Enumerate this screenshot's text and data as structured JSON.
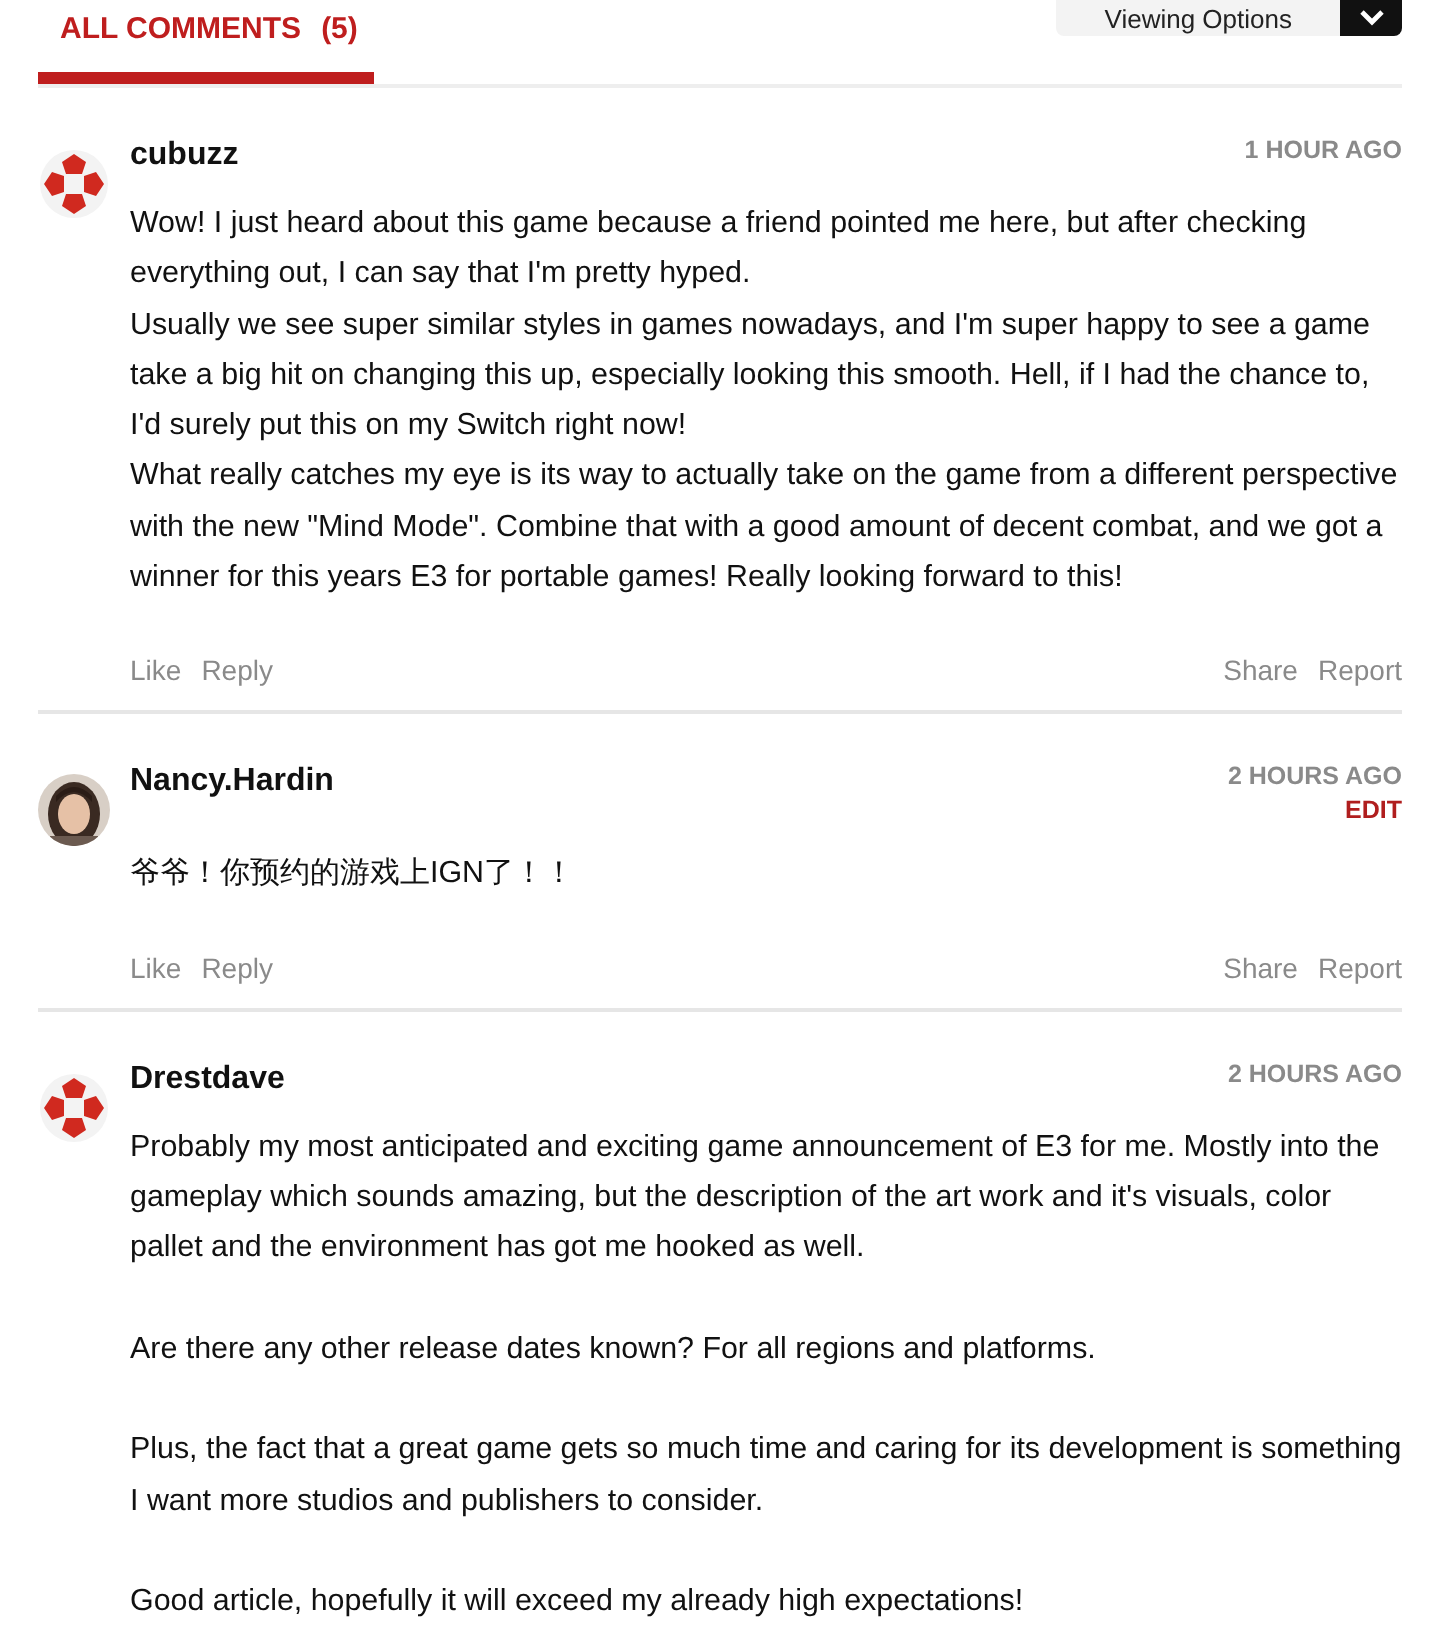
{
  "header": {
    "tab": {
      "label": "ALL COMMENTS",
      "count": "(5)",
      "selected": true
    },
    "viewing_options": {
      "label": "Viewing Options"
    }
  },
  "comments": [
    {
      "author": "cubuzz",
      "avatar": {
        "kind": "logo"
      },
      "time": "1 HOUR AGO",
      "spaced_paragraphs": false,
      "paragraphs": [
        "Wow! I just heard about this game because a friend pointed me here, but after checking everything out, I can say that I'm pretty hyped.",
        "Usually we see super similar styles in games nowadays, and I'm super happy to see a game take a big hit on changing this up, especially looking this smooth. Hell, if I had the chance to, I'd surely put this on my Switch right now!",
        "What really catches my eye is its way to actually take on the game from a different perspective with the new \"Mind Mode\". Combine that with a good amount of decent combat, and we got a winner for this years E3 for portable games! Really looking forward to this!"
      ],
      "actions": [
        "Like",
        "Reply"
      ],
      "side_actions": [
        "Share",
        "Report"
      ]
    },
    {
      "author": "Nancy.Hardin",
      "avatar": {
        "kind": "picture"
      },
      "time": "2 HOURS AGO",
      "edit_label": "EDIT",
      "spaced_paragraphs": false,
      "paragraphs": [
        "爷爷！你预约的游戏上IGN了！！"
      ],
      "actions": [
        "Like",
        "Reply"
      ],
      "side_actions": [
        "Share",
        "Report"
      ]
    },
    {
      "author": "Drestdave",
      "avatar": {
        "kind": "logo"
      },
      "time": "2 HOURS AGO",
      "spaced_paragraphs": true,
      "paragraphs": [
        "Probably my most anticipated and exciting game announcement of E3 for me. Mostly into the gameplay which sounds amazing, but the description of the art work and it's visuals, color pallet and the environment has got me hooked as well.",
        "Are there any other release dates known? For all regions and platforms.",
        "Plus, the fact that a great game gets so much time and caring for its development is something I want more studios and publishers to consider.",
        "Good article, hopefully it will exceed my already high expectations!"
      ]
    }
  ]
}
